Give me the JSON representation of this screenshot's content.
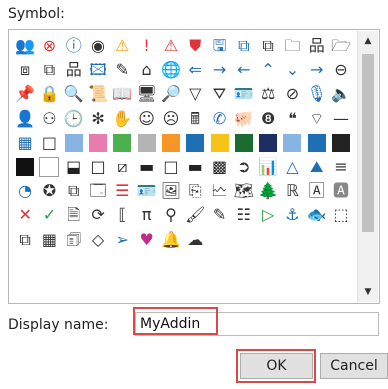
{
  "dialog": {
    "symbol_label": "Symbol:",
    "display_name_label": "Display name:",
    "display_name_value": "MyAddin",
    "ok_label": "OK",
    "cancel_label": "Cancel"
  },
  "highlight_color": "#d84a4a",
  "symbol_grid": [
    [
      {
        "icon": "org-chart-icon",
        "glyph": "👥",
        "color": "#1f6fb5"
      },
      {
        "icon": "cancel-circle-icon",
        "glyph": "⊗",
        "color": "#e0343c"
      },
      {
        "icon": "info-circle-icon",
        "glyph": "ⓘ",
        "color": "#1f6fb5"
      },
      {
        "icon": "radio-button-icon",
        "glyph": "◉",
        "color": "#333333"
      },
      {
        "icon": "warning-triangle-icon",
        "glyph": "⚠",
        "color": "#f4a000"
      },
      {
        "icon": "exclamation-icon",
        "glyph": "!",
        "color": "#e0343c"
      },
      {
        "icon": "alert-triangle-icon",
        "glyph": "⚠",
        "color": "#e0343c"
      },
      {
        "icon": "shield-icon",
        "glyph": "⛊",
        "color": "#e0343c"
      },
      {
        "icon": "save-icon",
        "glyph": "🖫",
        "color": "#1f6fb5"
      },
      {
        "icon": "document-copy-icon",
        "glyph": "⧉",
        "color": "#1f6fb5"
      },
      {
        "icon": "document-paste-icon",
        "glyph": "⧉",
        "color": "#333333"
      },
      {
        "icon": "folder-icon",
        "glyph": "🗀",
        "color": "#333333"
      }
    ],
    [
      {
        "icon": "hierarchy-icon",
        "glyph": "品",
        "color": "#333333"
      },
      {
        "icon": "open-folder-icon",
        "glyph": "🗁",
        "color": "#333333"
      },
      {
        "icon": "window-split-icon",
        "glyph": "⧈",
        "color": "#333333"
      },
      {
        "icon": "window-stack-icon",
        "glyph": "⧉",
        "color": "#333333"
      },
      {
        "icon": "network-icon",
        "glyph": "品",
        "color": "#333333"
      },
      {
        "icon": "picture-icon",
        "glyph": "🖾",
        "color": "#1f6fb5"
      },
      {
        "icon": "page-edit-icon",
        "glyph": "✎",
        "color": "#333333"
      },
      {
        "icon": "home-icon",
        "glyph": "⌂",
        "color": "#333333"
      },
      {
        "icon": "globe-icon",
        "glyph": "🌐",
        "color": "#333333"
      },
      {
        "icon": "arrow-left-icon",
        "glyph": "⇐",
        "color": "#1f6fb5"
      },
      {
        "icon": "arrow-right-icon",
        "glyph": "→",
        "color": "#1f6fb5"
      },
      {
        "icon": "arrow-back-icon",
        "glyph": "←",
        "color": "#1f6fb5"
      }
    ],
    [
      {
        "icon": "chevron-up-icon",
        "glyph": "⌃",
        "color": "#1f6fb5"
      },
      {
        "icon": "chevron-down-icon",
        "glyph": "⌄",
        "color": "#1f6fb5"
      },
      {
        "icon": "arrow-right-thin-icon",
        "glyph": "→",
        "color": "#1f6fb5"
      },
      {
        "icon": "back-circle-icon",
        "glyph": "⊖",
        "color": "#333333"
      },
      {
        "icon": "pin-icon",
        "glyph": "📌",
        "color": "#333333"
      },
      {
        "icon": "lock-icon",
        "glyph": "🔒",
        "color": "#333333"
      },
      {
        "icon": "search-icon",
        "glyph": "🔍",
        "color": "#333333"
      },
      {
        "icon": "scroll-icon",
        "glyph": "📜",
        "color": "#333333"
      },
      {
        "icon": "book-icon",
        "glyph": "📖",
        "color": "#333333"
      },
      {
        "icon": "monitor-icon",
        "glyph": "🖥",
        "color": "#333333"
      },
      {
        "icon": "magnifier-icon",
        "glyph": "🔎",
        "color": "#333333"
      },
      {
        "icon": "filter-icon",
        "glyph": "▽",
        "color": "#333333"
      }
    ],
    [
      {
        "icon": "funnel-icon",
        "glyph": "⛛",
        "color": "#333333"
      },
      {
        "icon": "id-card-icon",
        "glyph": "🪪",
        "color": "#333333"
      },
      {
        "icon": "scales-icon",
        "glyph": "⚖",
        "color": "#333333"
      },
      {
        "icon": "block-icon",
        "glyph": "⊘",
        "color": "#333333"
      },
      {
        "icon": "microphone-icon",
        "glyph": "🎙",
        "color": "#1f6fb5"
      },
      {
        "icon": "speaker-icon",
        "glyph": "🔈",
        "color": "#333333"
      },
      {
        "icon": "people-icon",
        "glyph": "👤",
        "color": "#333333"
      },
      {
        "icon": "person-icon",
        "glyph": "⚇",
        "color": "#333333"
      },
      {
        "icon": "clock-icon",
        "glyph": "🕒",
        "color": "#333333"
      },
      {
        "icon": "virus-icon",
        "glyph": "✻",
        "color": "#333333"
      },
      {
        "icon": "hand-icon",
        "glyph": "✋",
        "color": "#333333"
      },
      {
        "icon": "smile-icon",
        "glyph": "☺",
        "color": "#333333"
      }
    ],
    [
      {
        "icon": "sad-face-icon",
        "glyph": "☹",
        "color": "#333333"
      },
      {
        "icon": "calculator-icon",
        "glyph": "🖩",
        "color": "#333333"
      },
      {
        "icon": "phone-icon",
        "glyph": "✆",
        "color": "#1f6fb5"
      },
      {
        "icon": "piggy-bank-icon",
        "glyph": "🐖",
        "color": "#333333"
      },
      {
        "icon": "number-8-icon",
        "glyph": "❽",
        "color": "#333333"
      },
      {
        "icon": "quote-icon",
        "glyph": "❝",
        "color": "#333333"
      },
      {
        "icon": "wifi-icon",
        "glyph": "⌔",
        "color": "#333333"
      },
      {
        "icon": "minus-icon",
        "glyph": "—",
        "color": "#333333"
      },
      {
        "icon": "grid-icon",
        "glyph": "▦",
        "color": "#1f6fb5"
      },
      {
        "icon": "square-outline-icon",
        "glyph": "□",
        "color": "#333333"
      },
      {
        "icon": "swatch-light-blue",
        "glyph": "■",
        "color": "#87b4e0"
      },
      {
        "icon": "swatch-pink",
        "glyph": "■",
        "color": "#e87dae"
      }
    ],
    [
      {
        "icon": "swatch-green",
        "glyph": "■",
        "color": "#4caf50"
      },
      {
        "icon": "swatch-gray",
        "glyph": "■",
        "color": "#b4b4b4"
      },
      {
        "icon": "swatch-orange",
        "glyph": "■",
        "color": "#f79527"
      },
      {
        "icon": "swatch-blue",
        "glyph": "■",
        "color": "#1f6fb5"
      },
      {
        "icon": "swatch-yellow",
        "glyph": "■",
        "color": "#f6c319"
      },
      {
        "icon": "swatch-dark-green",
        "glyph": "■",
        "color": "#1b6d2f"
      },
      {
        "icon": "swatch-navy",
        "glyph": "■",
        "color": "#1d2e62"
      },
      {
        "icon": "swatch-light-blue-framed",
        "glyph": "■",
        "color": "#87b4e0"
      },
      {
        "icon": "swatch-diagonal-icon",
        "glyph": "◪",
        "color": "#1f6fb5"
      },
      {
        "icon": "swatch-half-black-icon",
        "glyph": "◩",
        "color": "#222222"
      },
      {
        "icon": "swatch-black",
        "glyph": "■",
        "color": "#111111"
      },
      {
        "icon": "swatch-blank",
        "glyph": "□",
        "color": "#ffffff"
      }
    ],
    [
      {
        "icon": "half-square-icon",
        "glyph": "⬓",
        "color": "#222222"
      },
      {
        "icon": "square-icon",
        "glyph": "□",
        "color": "#222222"
      },
      {
        "icon": "diagonal-square-icon",
        "glyph": "⧄",
        "color": "#222222"
      },
      {
        "icon": "dark-square-icon",
        "glyph": "▬",
        "color": "#222222"
      },
      {
        "icon": "empty-square-icon",
        "glyph": "□",
        "color": "#333333"
      },
      {
        "icon": "line-square-icon",
        "glyph": "▬",
        "color": "#222222"
      },
      {
        "icon": "qr-icon",
        "glyph": "▩",
        "color": "#222222"
      },
      {
        "icon": "arrow-circle-right-icon",
        "glyph": "➲",
        "color": "#333333"
      },
      {
        "icon": "bar-chart-icon",
        "glyph": "📊",
        "color": "#1f6fb5"
      },
      {
        "icon": "triangle-icon",
        "glyph": "△",
        "color": "#1f6fb5"
      },
      {
        "icon": "mountain-icon",
        "glyph": "⛰",
        "color": "#1f6fb5"
      },
      {
        "icon": "align-left-icon",
        "glyph": "≡",
        "color": "#333333"
      }
    ],
    [
      {
        "icon": "pie-chart-icon",
        "glyph": "◔",
        "color": "#1f6fb5"
      },
      {
        "icon": "award-icon",
        "glyph": "✪",
        "color": "#333333"
      },
      {
        "icon": "flowchart-icon",
        "glyph": "⧉",
        "color": "#333333"
      },
      {
        "icon": "dialog-icon",
        "glyph": "🗔",
        "color": "#333333"
      },
      {
        "icon": "list-box-icon",
        "glyph": "☰",
        "color": "#e0343c"
      },
      {
        "icon": "contact-card-icon",
        "glyph": "🪪",
        "color": "#1f6fb5"
      },
      {
        "icon": "image-icon",
        "glyph": "🖼",
        "color": "#333333"
      },
      {
        "icon": "copy-icon",
        "glyph": "⎘",
        "color": "#333333"
      },
      {
        "icon": "chart-window-icon",
        "glyph": "🗠",
        "color": "#333333"
      },
      {
        "icon": "picture-stack-icon",
        "glyph": "🗺",
        "color": "#333333"
      },
      {
        "icon": "tree-icon",
        "glyph": "🌲",
        "color": "#1f6fb5"
      },
      {
        "icon": "phonetic-icon",
        "glyph": "ℝ",
        "color": "#333333"
      }
    ],
    [
      {
        "icon": "letter-a-box-icon",
        "glyph": "🄰",
        "color": "#333333"
      },
      {
        "icon": "letter-a-shaded-icon",
        "glyph": "🅰",
        "color": "#888888"
      },
      {
        "icon": "close-x-icon",
        "glyph": "✕",
        "color": "#e0343c"
      },
      {
        "icon": "checkmark-icon",
        "glyph": "✓",
        "color": "#2e9e47"
      },
      {
        "icon": "edit-document-icon",
        "glyph": "🗎",
        "color": "#333333"
      },
      {
        "icon": "refresh-icon",
        "glyph": "⟳",
        "color": "#333333"
      },
      {
        "icon": "brackets-icon",
        "glyph": "⟦",
        "color": "#333333"
      },
      {
        "icon": "pi-icon",
        "glyph": "π",
        "color": "#333333"
      },
      {
        "icon": "stamp-icon",
        "glyph": "⚲",
        "color": "#333333"
      },
      {
        "icon": "paint-icon",
        "glyph": "🖌",
        "color": "#333333"
      },
      {
        "icon": "pen-icon",
        "glyph": "✎",
        "color": "#333333"
      },
      {
        "icon": "bullets-icon",
        "glyph": "☷",
        "color": "#333333"
      }
    ],
    [
      {
        "icon": "play-icon",
        "glyph": "▷",
        "color": "#2e9e47"
      },
      {
        "icon": "anchor-icon",
        "glyph": "⚓",
        "color": "#1f6fb5"
      },
      {
        "icon": "fish-icon",
        "glyph": "🐟",
        "color": "#333333"
      },
      {
        "icon": "selection-icon",
        "glyph": "⬚",
        "color": "#333333"
      },
      {
        "icon": "flowchart-small-icon",
        "glyph": "⧉",
        "color": "#333333"
      },
      {
        "icon": "table-icon",
        "glyph": "▦",
        "color": "#333333"
      },
      {
        "icon": "note-icon",
        "glyph": "🗊",
        "color": "#333333"
      },
      {
        "icon": "diamond-icon",
        "glyph": "◇",
        "color": "#333333"
      },
      {
        "icon": "send-icon",
        "glyph": "➢",
        "color": "#1f6fb5"
      },
      {
        "icon": "heart-color-icon",
        "glyph": "♥",
        "color": "#c12b8c"
      },
      {
        "icon": "bell-icon",
        "glyph": "🔔",
        "color": "#333333"
      },
      {
        "icon": "cloud-icon",
        "glyph": "☁",
        "color": "#333333"
      }
    ]
  ]
}
